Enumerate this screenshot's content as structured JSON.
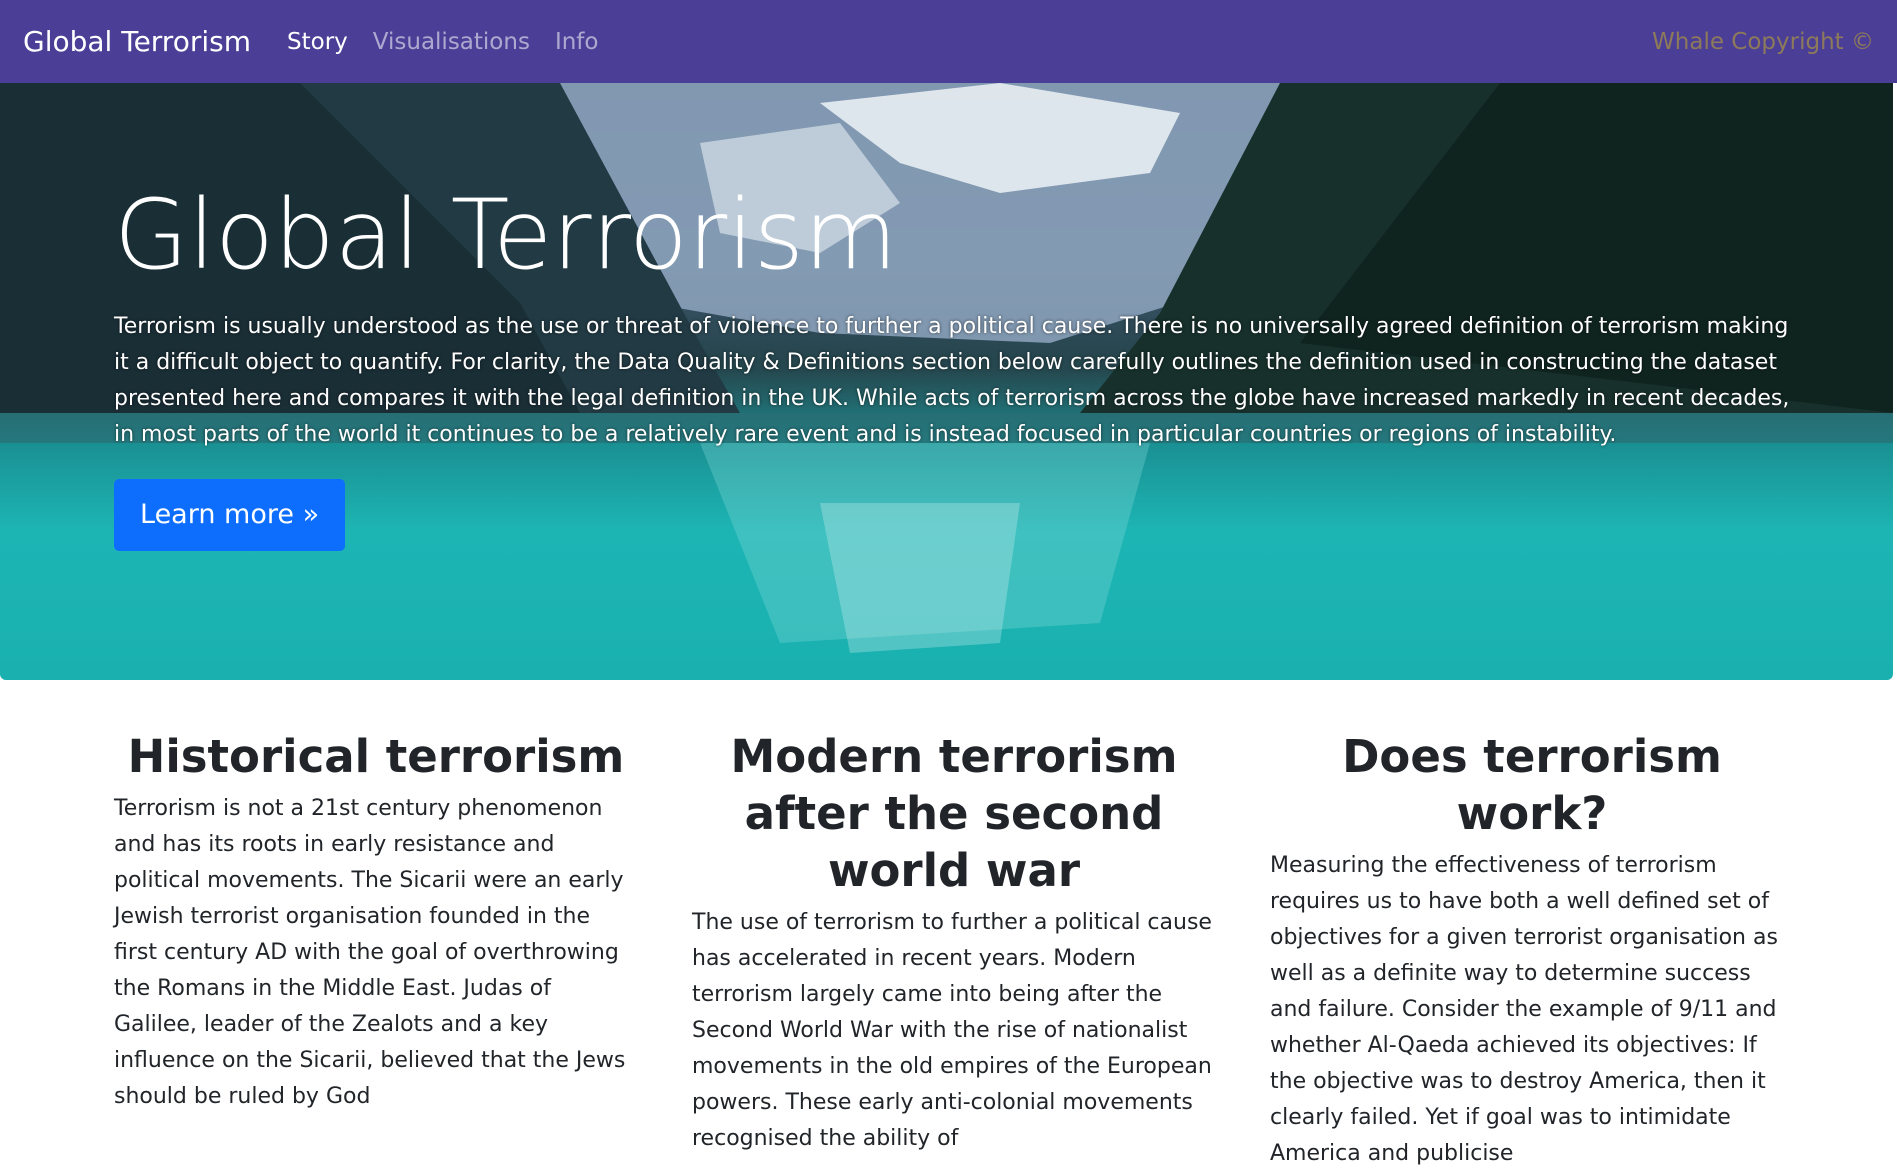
{
  "navbar": {
    "brand": "Global Terrorism",
    "links": [
      {
        "label": "Story",
        "active": true
      },
      {
        "label": "Visualisations",
        "active": false
      },
      {
        "label": "Info",
        "active": false
      }
    ],
    "copyright": "Whale Copyright ©",
    "background": "#4b3e96"
  },
  "hero": {
    "title": "Global Terrorism",
    "text": "Terrorism is usually understood as the use or threat of violence to further a political cause. There is no universally agreed definition of terrorism making it a difficult object to quantify. For clarity, the Data Quality & Definitions section below carefully outlines the definition used in constructing the dataset presented here and compares it with the legal definition in the UK. While acts of terrorism across the globe have increased markedly in recent decades, in most parts of the world it continues to be a relatively rare event and is instead focused in particular countries or regions of instability.",
    "button_label": "Learn more »",
    "button_color": "#0d6efd"
  },
  "columns": [
    {
      "heading": "Historical terrorism",
      "text": "Terrorism is not a 21st century phenomenon and has its roots in early resistance and political movements. The Sicarii were an early Jewish terrorist organisation founded in the first century AD with the goal of overthrowing the Romans in the Middle East. Judas of Galilee, leader of the Zealots and a key influence on the Sicarii, believed that the Jews should be ruled by God"
    },
    {
      "heading": "Modern terrorism after the second world war",
      "text": "The use of terrorism to further a political cause has accelerated in recent years. Modern terrorism largely came into being after the Second World War with the rise of nationalist movements in the old empires of the European powers. These early anti-colonial movements recognised the ability of"
    },
    {
      "heading": "Does terrorism work?",
      "text": "Measuring the effectiveness of terrorism requires us to have both a well defined set of objectives for a given terrorist organisation as well as a definite way to determine success and failure. Consider the example of 9/11 and whether Al-Qaeda achieved its objectives: If the objective was to destroy America, then it clearly failed. Yet if goal was to intimidate America and publicise"
    }
  ]
}
